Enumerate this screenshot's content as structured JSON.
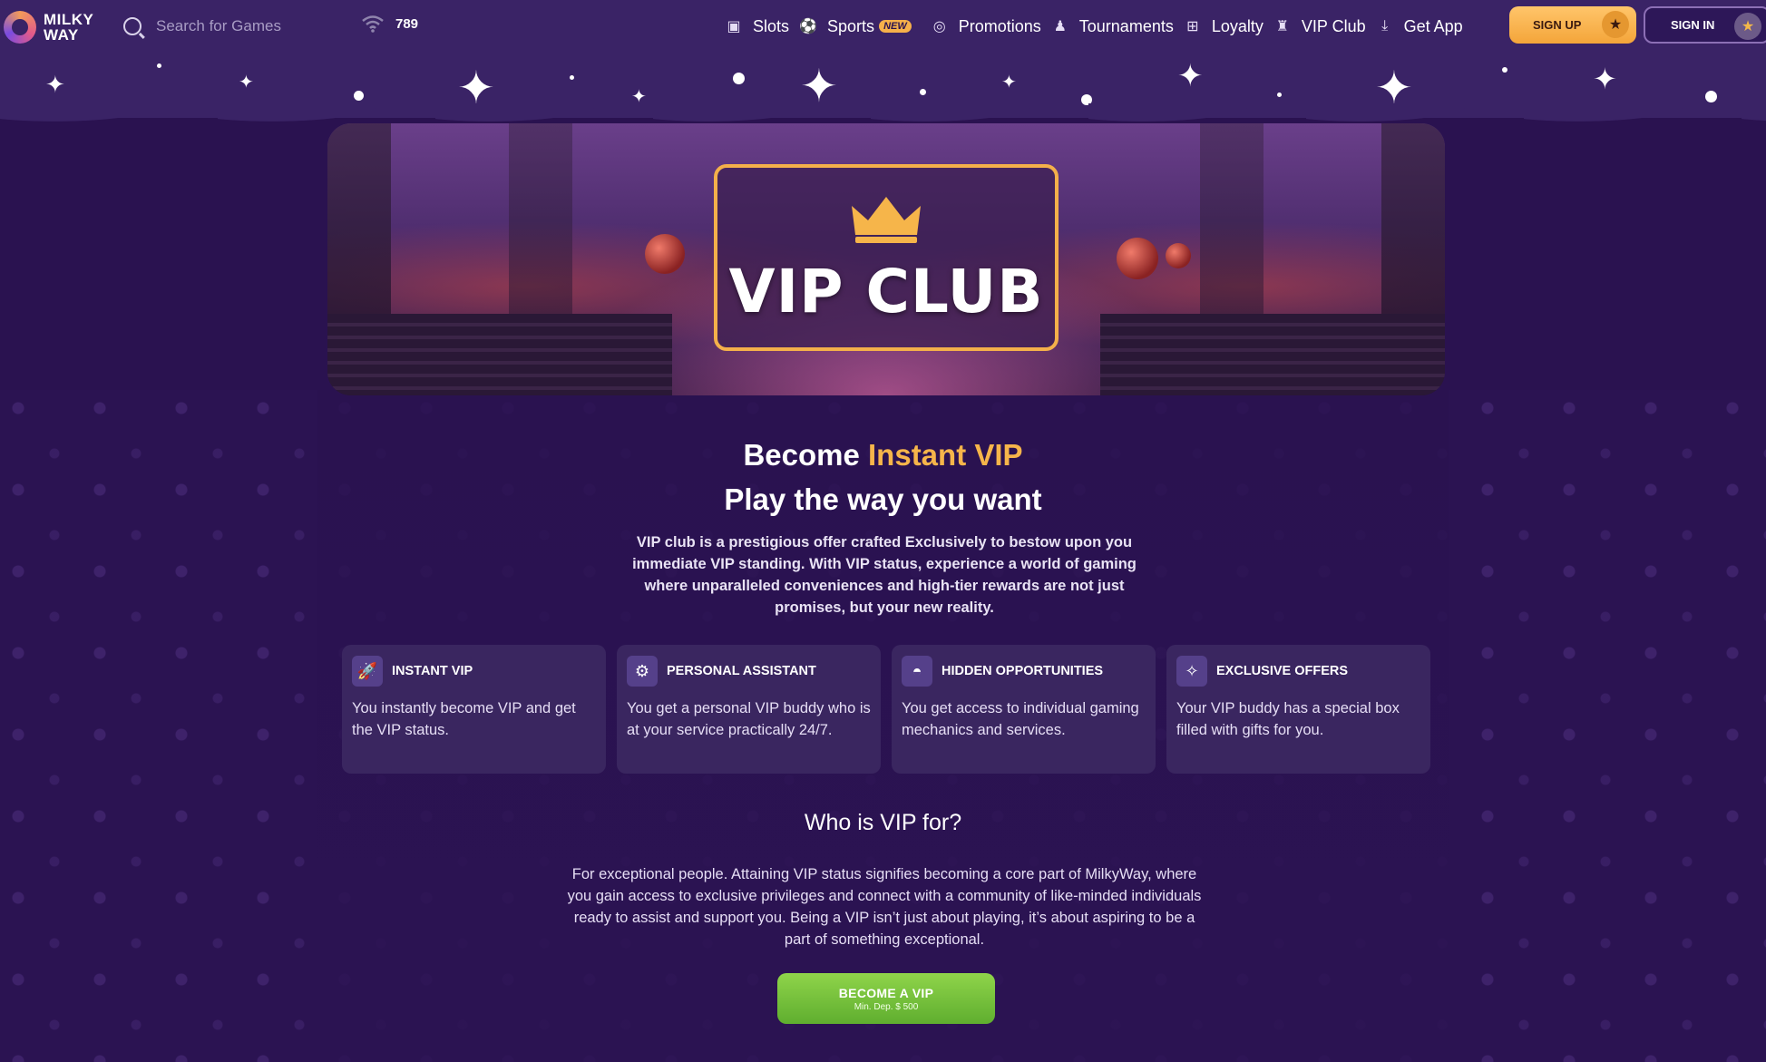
{
  "header": {
    "logo_line1": "MILKY",
    "logo_line2": "WAY",
    "search_placeholder": "Search for Games",
    "online_count": "789",
    "nav": [
      {
        "label": "Slots",
        "icon": "slot-machine-icon"
      },
      {
        "label": "Sports",
        "icon": "soccer-ball-icon",
        "badge": "NEW"
      },
      {
        "label": "Promotions",
        "icon": "target-icon"
      },
      {
        "label": "Tournaments",
        "icon": "podium-icon"
      },
      {
        "label": "Loyalty",
        "icon": "loyalty-icon"
      },
      {
        "label": "VIP Club",
        "icon": "castle-icon"
      },
      {
        "label": "Get App",
        "icon": "download-icon"
      }
    ],
    "signup_label": "SIGN UP",
    "signin_label": "SIGN IN"
  },
  "banner": {
    "title": "VIP CLUB",
    "icon": "crown-icon"
  },
  "hero": {
    "line1_prefix": "Become ",
    "line1_accent": "Instant VIP",
    "line2": "Play the way you want",
    "intro": "VIP club is a prestigious offer crafted Exclusively to bestow upon you immediate VIP standing. With VIP status, experience a world of gaming where unparalleled conveniences and high-tier rewards are not just promises, but your new reality."
  },
  "cards": [
    {
      "icon": "rocket-icon",
      "title": "INSTANT VIP",
      "text": "You instantly become VIP and get the VIP status."
    },
    {
      "icon": "robot-icon",
      "title": "PERSONAL ASSISTANT",
      "text": "You get a personal VIP buddy who is at your service practically 24/7."
    },
    {
      "icon": "ufo-icon",
      "title": "HIDDEN OPPORTUNITIES",
      "text": "You get access to individual gaming mechanics and services."
    },
    {
      "icon": "gift-stars-icon",
      "title": "EXCLUSIVE OFFERS",
      "text": "Your VIP buddy has a special box filled with gifts for you."
    }
  ],
  "who": {
    "title": "Who is VIP for?",
    "text": "For exceptional people. Attaining VIP status signifies becoming a core part of MilkyWay, where you gain access to exclusive privileges and connect with a community of like-minded individuals ready to assist and support you. Being a VIP isn’t just about playing, it’s about aspiring to be a part of something exceptional."
  },
  "cta": {
    "label": "BECOME A VIP",
    "sub": "Min. Dep. $ 500"
  },
  "colors": {
    "accent": "#f6b54a",
    "background": "#2a1250",
    "header": "#3a2366",
    "card": "#3a2660",
    "cta": "#7cc23e"
  }
}
